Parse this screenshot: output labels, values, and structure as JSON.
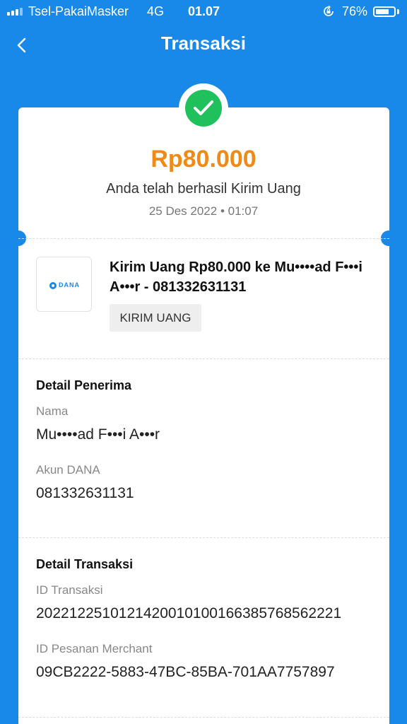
{
  "status_bar": {
    "carrier": "Tsel-PakaiMasker",
    "network": "4G",
    "time": "01.07",
    "battery_percent": "76%",
    "battery_level": 0.76
  },
  "nav": {
    "title": "Transaksi",
    "back_icon": "chevron-left-icon"
  },
  "summary": {
    "amount": "Rp80.000",
    "status_text": "Anda telah berhasil Kirim Uang",
    "datetime": "25 Des 2022 • 01:07",
    "status_icon": "check-circle-icon"
  },
  "transaction": {
    "logo_text": "DANA",
    "title": "Kirim Uang Rp80.000 ke Mu••••ad F•••i A•••r - 081332631131",
    "tag": "KIRIM UANG"
  },
  "recipient": {
    "section_title": "Detail Penerima",
    "name_label": "Nama",
    "name_value": "Mu••••ad F•••i A•••r",
    "account_label": "Akun DANA",
    "account_value": "081332631131"
  },
  "details": {
    "section_title": "Detail Transaksi",
    "id_label": "ID Transaksi",
    "id_value": "2022122510121420010100166385768562221",
    "order_label": "ID Pesanan Merchant",
    "order_value": "09CB2222-5883-47BC-85BA-701AA7757897"
  },
  "colors": {
    "brand_blue": "#1889E8",
    "amount_orange": "#F08A16",
    "success_green": "#20C05C"
  }
}
